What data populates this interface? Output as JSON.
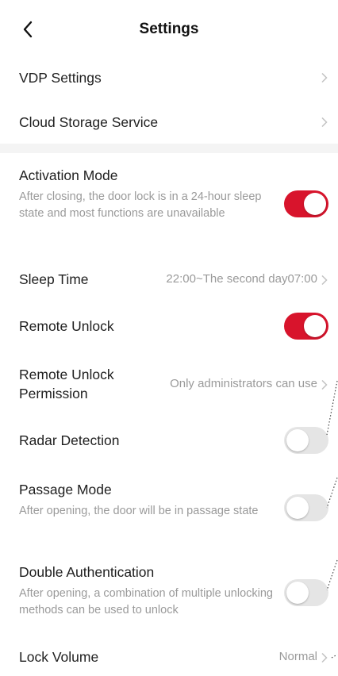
{
  "header": {
    "title": "Settings"
  },
  "rows": {
    "vdp": {
      "label": "VDP Settings"
    },
    "cloud": {
      "label": "Cloud Storage Service"
    },
    "activation": {
      "label": "Activation Mode",
      "desc": "After closing, the door lock is in a 24-hour sleep state and most functions are unavailable",
      "toggle": "on"
    },
    "sleep": {
      "label": "Sleep Time",
      "value": "22:00~The second day07:00"
    },
    "remote_unlock": {
      "label": "Remote Unlock",
      "toggle": "on"
    },
    "remote_permission": {
      "label": "Remote Unlock Permission",
      "value": "Only administrators can use"
    },
    "radar": {
      "label": "Radar Detection",
      "toggle": "off"
    },
    "passage": {
      "label": "Passage Mode",
      "desc": "After opening, the door will be in passage state",
      "toggle": "off"
    },
    "double_auth": {
      "label": "Double Authentication",
      "desc": "After opening, a combination of multiple unlocking methods can be used to unlock",
      "toggle": "off"
    },
    "volume": {
      "label": "Lock Volume",
      "value": "Normal"
    }
  },
  "colors": {
    "toggle_on": "#d8142c",
    "toggle_off": "#e5e5e5",
    "secondary_text": "#9a9a9a"
  }
}
